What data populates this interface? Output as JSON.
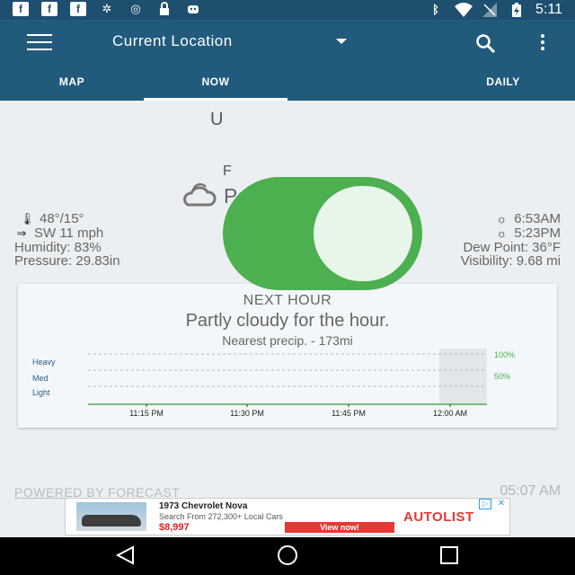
{
  "status_bar": {
    "time": "5:11",
    "left_icons": [
      "facebook-icon",
      "facebook-icon",
      "facebook-icon",
      "fan-icon",
      "vpn-icon",
      "lock-icon",
      "android-icon"
    ],
    "right_icons": [
      "bluetooth-icon",
      "wifi-icon",
      "no-signal-icon",
      "battery-charging-icon"
    ]
  },
  "app_bar": {
    "title": "Current Location"
  },
  "tabs": [
    {
      "label": "MAP",
      "active": false
    },
    {
      "label": "NOW",
      "active": true
    },
    {
      "label": "",
      "active": false
    },
    {
      "label": "DAILY",
      "active": false
    }
  ],
  "current": {
    "temp_fragment": "U",
    "feels_fragment": "F",
    "summary": "Partly Cloudy",
    "high_low": "48°/15°",
    "wind": "SW 11 mph",
    "humidity": "Humidity: 83%",
    "pressure": "Pressure: 29.83in",
    "sunrise": "6:53AM",
    "sunset": "5:23PM",
    "dew_point": "Dew Point: 36°F",
    "visibility": "Visibility: 9.68 mi"
  },
  "next_hour": {
    "title": "NEXT HOUR",
    "summary": "Partly cloudy for the hour.",
    "nearest": "Nearest precip. - 173mi"
  },
  "chart_data": {
    "type": "line",
    "title": "",
    "x_ticks": [
      "11:15 PM",
      "11:30 PM",
      "11:45 PM",
      "12:00 AM"
    ],
    "y_levels": [
      "Heavy",
      "Med",
      "Light"
    ],
    "right_ticks": [
      "100%",
      "50%"
    ],
    "series": [
      {
        "values": [
          0,
          0,
          0,
          0
        ]
      }
    ],
    "colors": {
      "line": "#4caf50",
      "grid": "#bbbbbb",
      "label": "#2e5e82",
      "pct": "#4caf50"
    }
  },
  "footer": {
    "powered_by": "POWERED BY FORECAST",
    "updated_time": "05:07 AM"
  },
  "ad": {
    "title": "1973 Chevrolet Nova",
    "subtitle": "Search From 272,300+ Local Cars",
    "price": "$8,997",
    "cta": "View now!",
    "brand": "AUTOLIST",
    "close": "✕",
    "choice": "▷"
  },
  "colors": {
    "app_bar": "#225a7c",
    "status_bar": "#1e4f6e",
    "accent_green": "#4caf50"
  }
}
